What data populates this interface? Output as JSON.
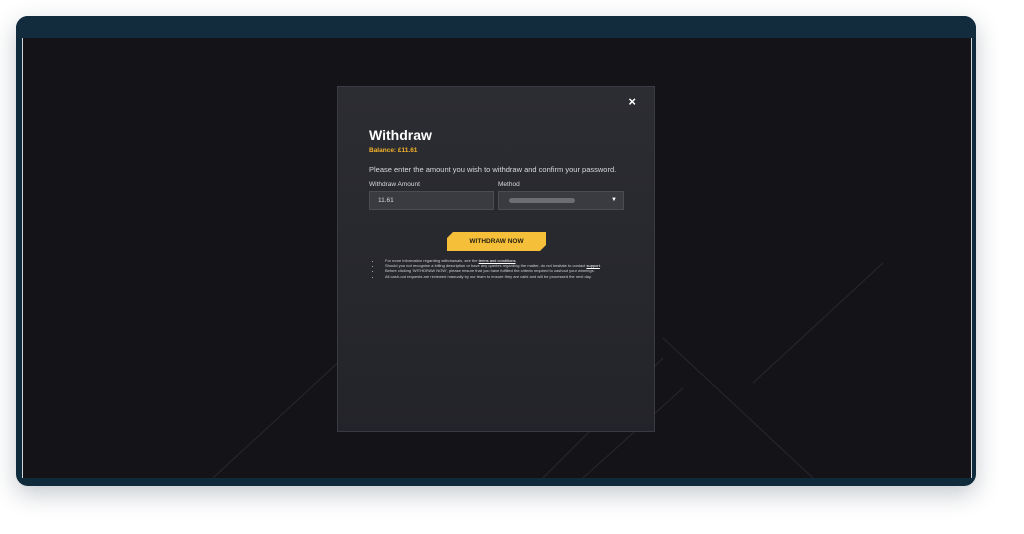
{
  "modal": {
    "close_symbol": "×",
    "title": "Withdraw",
    "balance": "Balance: £11.61",
    "instruction": "Please enter the amount you wish to withdraw and confirm your password.",
    "amount_label": "Withdraw Amount",
    "amount_value": "11.61",
    "method_label": "Method",
    "method_caret": "▼",
    "button_label": "WITHDRAW NOW",
    "notes": {
      "note1_prefix": "For more information regarding withdrawals, see the ",
      "note1_link": "terms and conditions",
      "note1_suffix": ".",
      "note2_prefix": "Should you not recognise a billing description or have any queries regarding the matter, do not hesitate to contact ",
      "note2_link": "support",
      "note2_suffix": ".",
      "note3": "Before clicking 'WITHDRAW NOW', please ensure that you have fulfilled the criteria required to cashout your winnings.",
      "note4": "All cash-out requests are reviewed manually by our team to ensure they are valid and will be processed the next day."
    }
  },
  "colors": {
    "accent": "#f5bf3a",
    "balance": "#f5b32b",
    "frame": "#0f2a3a",
    "screen_bg": "#141418",
    "modal_bg": "#2c2d33"
  },
  "icons": {
    "close": "close-icon",
    "dropdown": "chevron-down-icon"
  }
}
